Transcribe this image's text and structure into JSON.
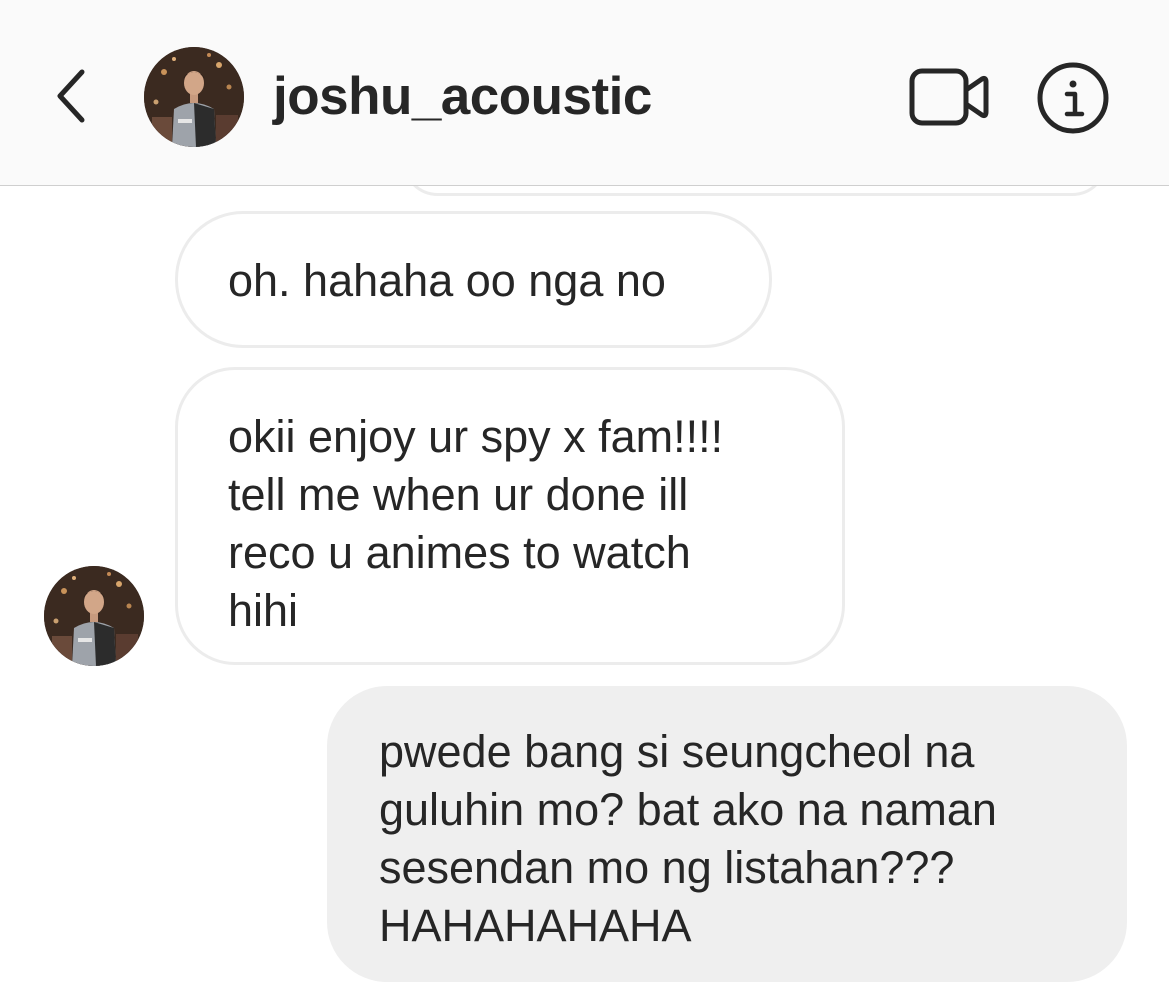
{
  "header": {
    "username": "joshu_acoustic",
    "back_icon": "chevron-left-icon",
    "video_icon": "video-camera-icon",
    "info_icon": "info-icon"
  },
  "messages": [
    {
      "sender": "joshu_acoustic",
      "direction": "incoming",
      "lines": [
        "oh. hahaha oo nga no"
      ]
    },
    {
      "sender": "joshu_acoustic",
      "direction": "incoming",
      "lines": [
        "okii enjoy ur spy x fam!!!!",
        "tell me when ur done ill",
        "reco u animes to watch",
        "hihi"
      ]
    },
    {
      "sender": "me",
      "direction": "outgoing",
      "lines": [
        "pwede bang si seungcheol na",
        "guluhin mo? bat ako na naman",
        "sesendan mo ng listahan???",
        "HAHAHAHAHA"
      ]
    }
  ],
  "colors": {
    "header_bg": "#fafafa",
    "incoming_border": "#ececec",
    "outgoing_bg": "#efefef",
    "text": "#262626"
  }
}
